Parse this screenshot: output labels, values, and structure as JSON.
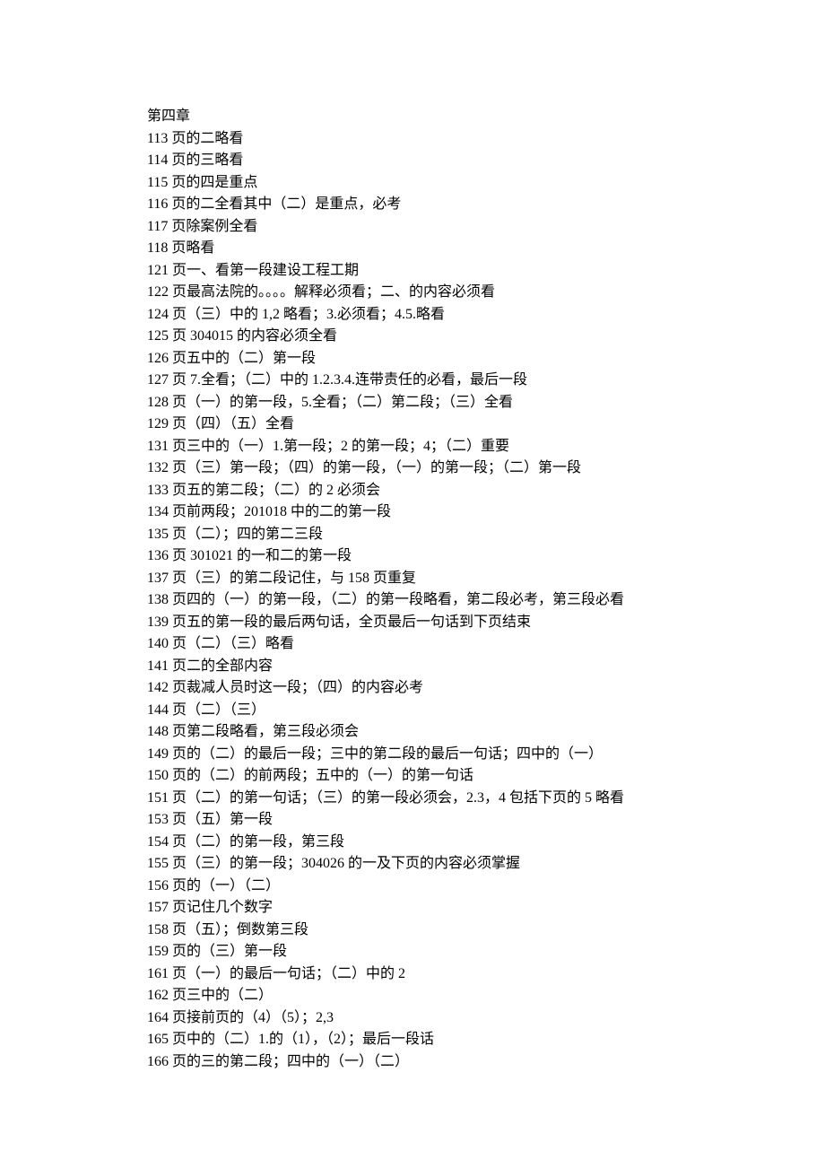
{
  "heading": "第四章",
  "lines": [
    "113 页的二略看",
    "114 页的三略看",
    "115 页的四是重点",
    "116 页的二全看其中（二）是重点，必考",
    "117 页除案例全看",
    "118 页略看",
    "121 页一、看第一段建设工程工期",
    "122 页最高法院的。。。。解释必须看；二、的内容必须看",
    "124 页（三）中的 1,2 略看；3.必须看；4.5.略看",
    "125 页 304015 的内容必须全看",
    "126 页五中的（二）第一段",
    "127 页 7.全看；（二）中的 1.2.3.4.连带责任的必看，最后一段",
    "128 页（一）的第一段，5.全看；（二）第二段；（三）全看",
    "129 页（四）（五）全看",
    "131 页三中的（一）1.第一段；2 的第一段；4；（二）重要",
    "132 页（三）第一段；（四）的第一段，（一）的第一段；（二）第一段",
    "133 页五的第二段；（二）的 2 必须会",
    "134 页前两段；201018 中的二的第一段",
    "135 页（二）；四的第二三段",
    "136 页 301021 的一和二的第一段",
    "137 页（三）的第二段记住，与 158 页重复",
    "138 页四的（一）的第一段，（二）的第一段略看，第二段必考，第三段必看",
    "139 页五的第一段的最后两句话，全页最后一句话到下页结束",
    "140 页（二）（三）略看",
    "141 页二的全部内容",
    "142 页裁减人员时这一段；（四）的内容必考",
    "144 页（二）（三）",
    "148 页第二段略看，第三段必须会",
    "149 页的（二）的最后一段；三中的第二段的最后一句话；四中的（一）",
    "150 页的（二）的前两段；五中的（一）的第一句话",
    "151 页（二）的第一句话；（三）的第一段必须会，2.3，4 包括下页的 5 略看",
    "153 页（五）第一段",
    "154 页（二）的第一段，第三段",
    "155 页（三）的第一段；304026 的一及下页的内容必须掌握",
    "156 页的（一）（二）",
    "157 页记住几个数字",
    "158 页（五）；倒数第三段",
    "159 页的（三）第一段",
    "161 页（一）的最后一句话；（二）中的 2",
    "162 页三中的（二）",
    "164 页接前页的（4）（5）；2,3",
    "165 页中的（二）1.的（1），（2）；最后一段话",
    "166 页的三的第二段；四中的（一）（二）"
  ]
}
